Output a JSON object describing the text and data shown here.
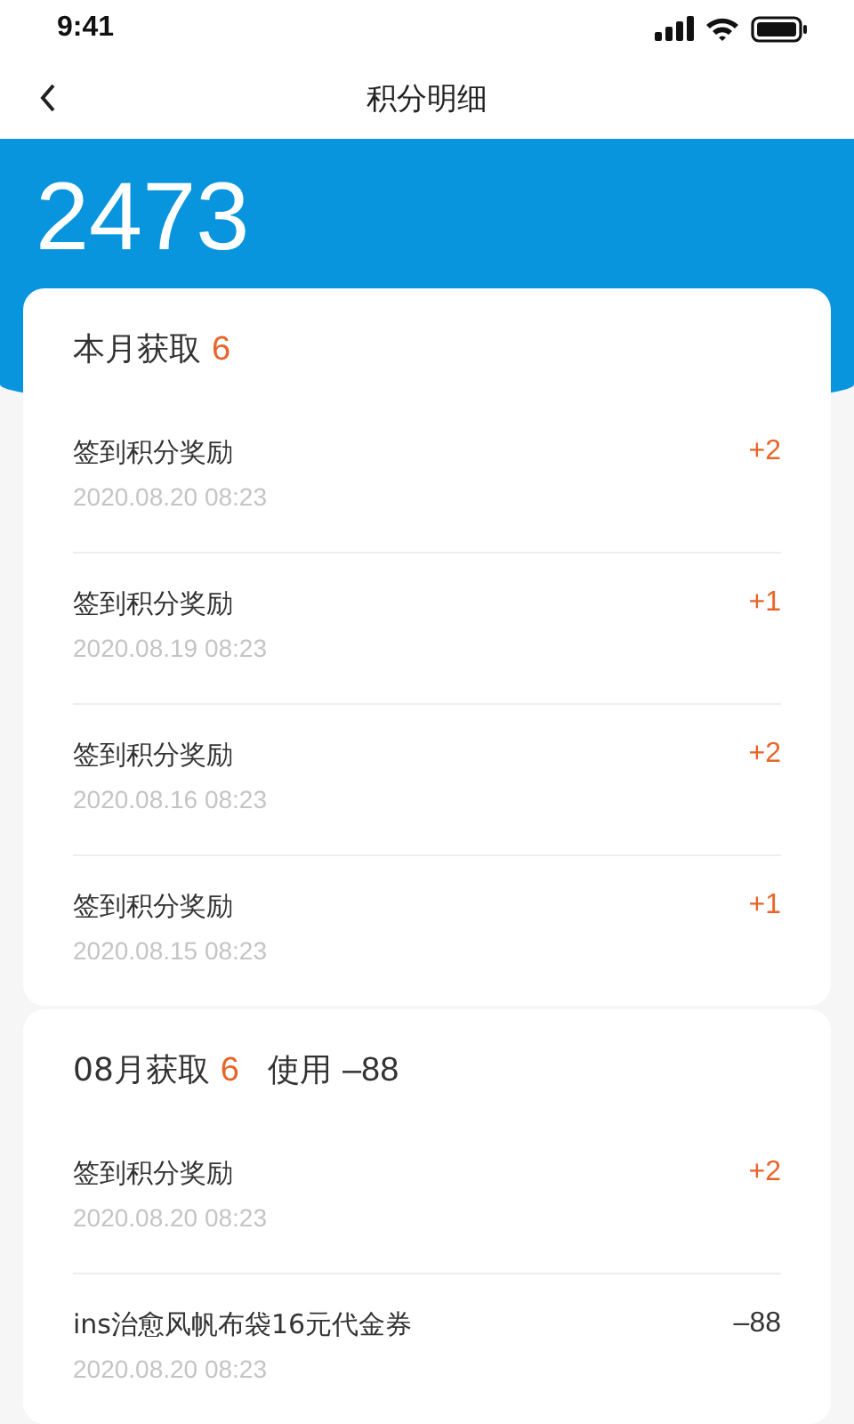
{
  "status_bar": {
    "time": "9:41"
  },
  "nav": {
    "title": "积分明细"
  },
  "balance": "2473",
  "sections": [
    {
      "label": "本月获取",
      "earned": "6",
      "records": [
        {
          "title": "签到积分奖励",
          "time": "2020.08.20 08:23",
          "amount": "+2",
          "kind": "gain"
        },
        {
          "title": "签到积分奖励",
          "time": "2020.08.19 08:23",
          "amount": "+1",
          "kind": "gain"
        },
        {
          "title": "签到积分奖励",
          "time": "2020.08.16 08:23",
          "amount": "+2",
          "kind": "gain"
        },
        {
          "title": "签到积分奖励",
          "time": "2020.08.15 08:23",
          "amount": "+1",
          "kind": "gain"
        }
      ]
    },
    {
      "label": "08月获取",
      "earned": "6",
      "used_label": "使用",
      "used": "–88",
      "records": [
        {
          "title": "签到积分奖励",
          "time": "2020.08.20 08:23",
          "amount": "+2",
          "kind": "gain"
        },
        {
          "title": "ins治愈风帆布袋16元代金券",
          "time": "2020.08.20 08:23",
          "amount": "–88",
          "kind": "spend"
        }
      ]
    }
  ]
}
